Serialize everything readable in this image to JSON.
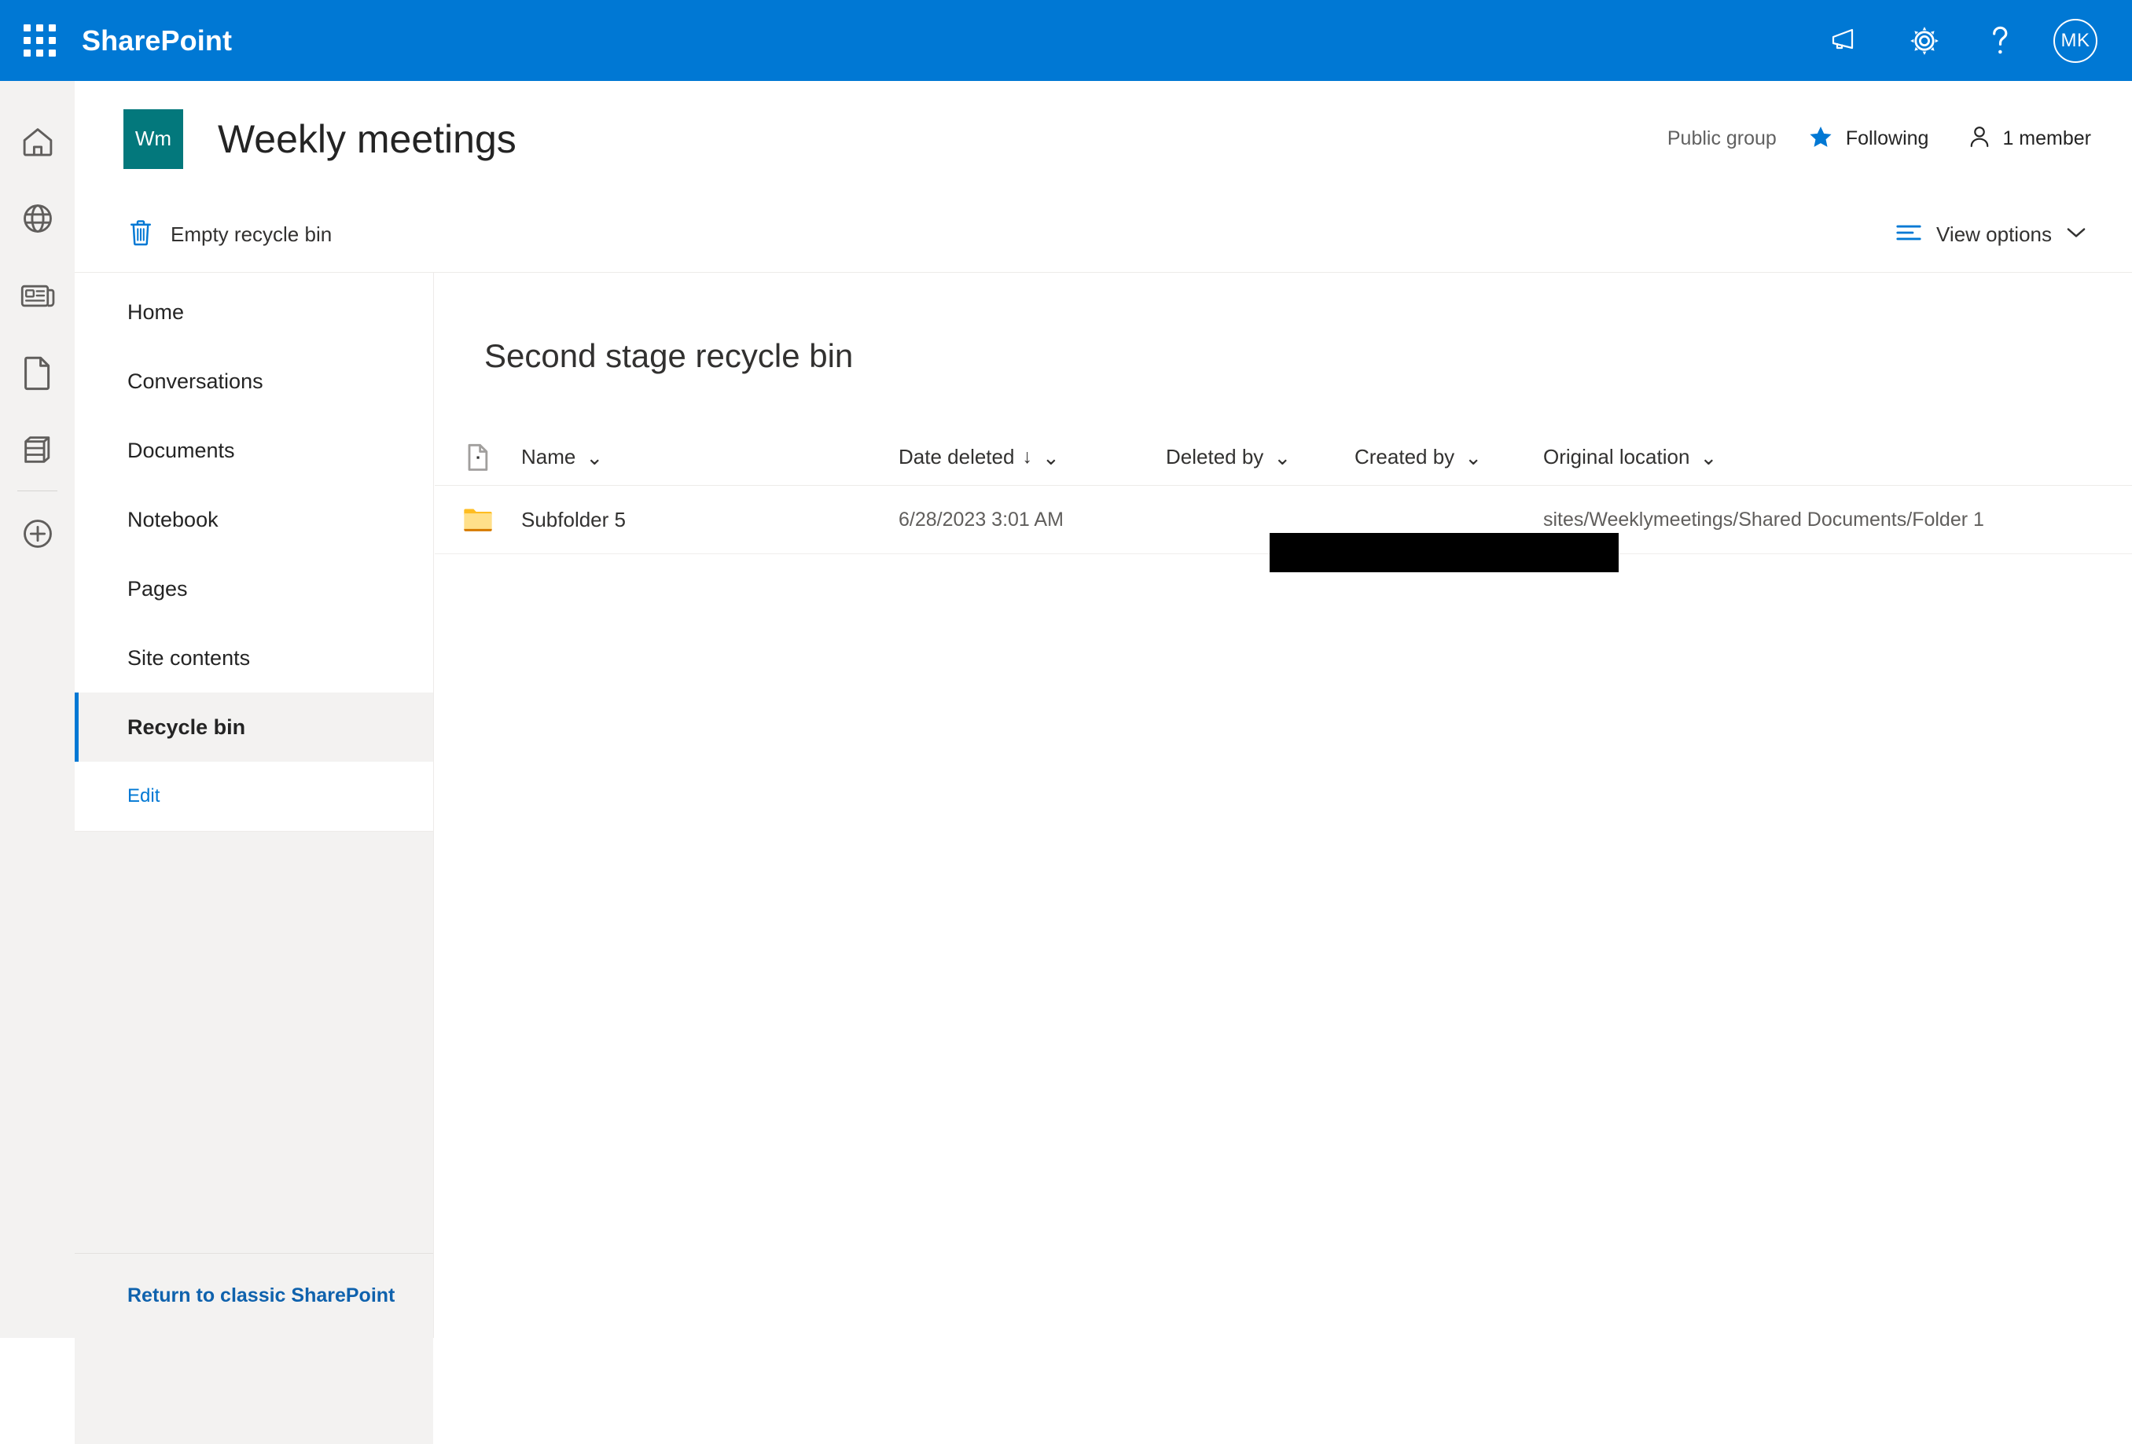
{
  "suite": {
    "brand": "SharePoint",
    "waffle_icon": "app-launcher-icon",
    "actions": [
      {
        "name": "megaphone-icon",
        "label": ""
      },
      {
        "name": "gear-icon",
        "label": ""
      },
      {
        "name": "help-icon",
        "label": "?"
      }
    ],
    "avatar_initials": "MK",
    "background_color": "#0078d4"
  },
  "app_rail": {
    "items": [
      {
        "name": "home-icon",
        "label": "Home"
      },
      {
        "name": "globe-icon",
        "label": "SharePoint"
      },
      {
        "name": "news-icon",
        "label": "News"
      },
      {
        "name": "document-icon",
        "label": "Files"
      },
      {
        "name": "lists-icon",
        "label": "Lists"
      },
      {
        "name": "create-icon",
        "label": "Create"
      }
    ]
  },
  "site_header": {
    "logo_initials": "Wm",
    "logo_color": "#03787c",
    "title": "Weekly meetings",
    "privacy": "Public group",
    "following_label": "Following",
    "following_star_color": "#0078d4",
    "members_label": "1 member"
  },
  "command_bar": {
    "empty_recycle_bin_label": "Empty recycle bin",
    "empty_recycle_bin_icon": "trash-icon",
    "view_options_label": "View options",
    "view_options_icon": "list-view-icon",
    "chevron": "⌄",
    "accent_color": "#0078d4"
  },
  "left_nav": {
    "items": [
      {
        "label": "Home",
        "selected": false
      },
      {
        "label": "Conversations",
        "selected": false
      },
      {
        "label": "Documents",
        "selected": false
      },
      {
        "label": "Notebook",
        "selected": false
      },
      {
        "label": "Pages",
        "selected": false
      },
      {
        "label": "Site contents",
        "selected": false
      },
      {
        "label": "Recycle bin",
        "selected": true
      }
    ],
    "edit_label": "Edit",
    "classic_link_label": "Return to classic SharePoint",
    "selected_indicator_color": "#0078d4"
  },
  "main": {
    "page_title": "Second stage recycle bin",
    "table": {
      "icon_column_icon": "document-header-icon",
      "columns": [
        {
          "label": "Name",
          "sorted": false,
          "chevron": "⌄"
        },
        {
          "label": "Date deleted",
          "sorted": true,
          "sort_direction": "↓",
          "chevron": "⌄"
        },
        {
          "label": "Deleted by",
          "sorted": false,
          "chevron": "⌄"
        },
        {
          "label": "Created by",
          "sorted": false,
          "chevron": "⌄"
        },
        {
          "label": "Original location",
          "sorted": false,
          "chevron": "⌄"
        }
      ],
      "rows": [
        {
          "icon": "folder-icon",
          "name": "Subfolder 5",
          "date_deleted": "6/28/2023 3:01 AM",
          "deleted_by": "",
          "created_by": "",
          "original_location": "sites/Weeklymeetings/Shared Documents/Folder 1",
          "redacted": true
        }
      ]
    }
  }
}
